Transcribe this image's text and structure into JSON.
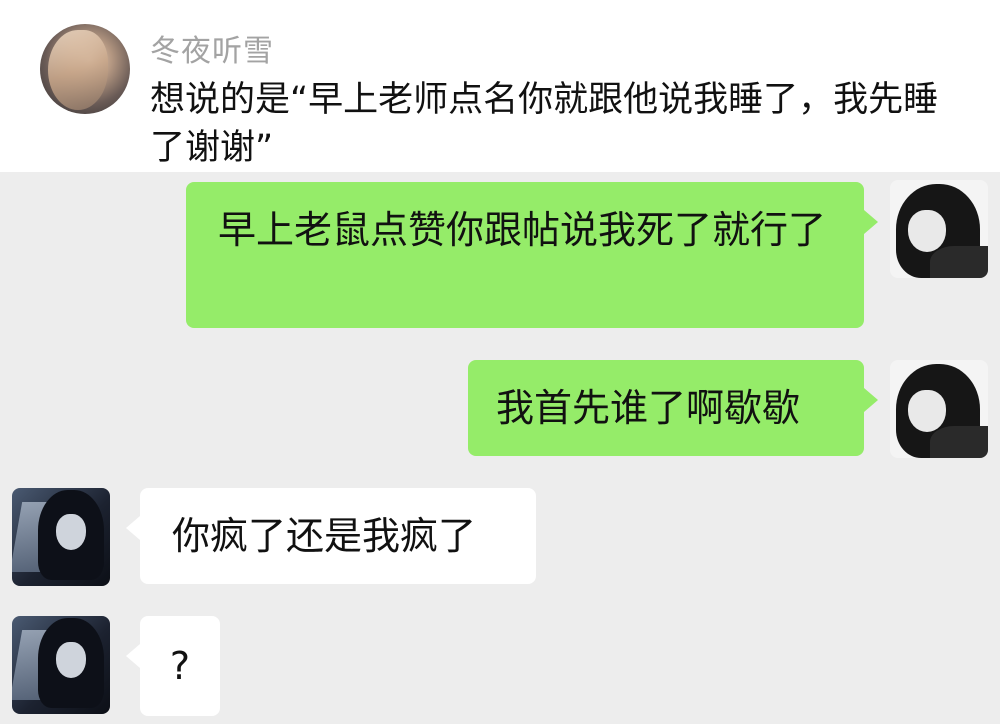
{
  "quoted_post": {
    "author": "冬夜听雪",
    "text": "想说的是“早上老师点名你就跟他说我睡了，我先睡了谢谢”"
  },
  "messages": [
    {
      "side": "me",
      "text": "早上老鼠点赞你跟帖说我死了就行了"
    },
    {
      "side": "me",
      "text": "我首先谁了啊歇歇"
    },
    {
      "side": "them",
      "text": "你疯了还是我疯了"
    },
    {
      "side": "them",
      "text": "?"
    }
  ],
  "colors": {
    "my_bubble": "#95ec69",
    "their_bubble": "#ffffff",
    "chat_background": "#ededed"
  },
  "icons": {
    "author_avatar": "avatar-photo-icon",
    "my_avatar": "anime-avatar-icon",
    "their_avatar": "anime-avatar-icon"
  }
}
